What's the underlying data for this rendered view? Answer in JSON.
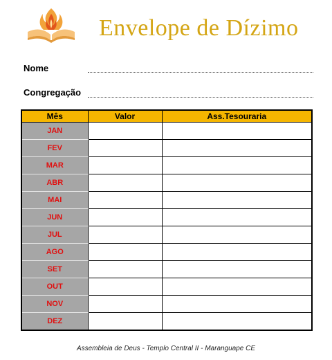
{
  "header": {
    "logo_icon": "bible-flame-logo",
    "title": "Envelope de Dízimo",
    "title_color": "#d4a514"
  },
  "form": {
    "name_label": "Nome",
    "congregation_label": "Congregação"
  },
  "table": {
    "columns": [
      "Mês",
      "Valor",
      "Ass.Tesouraria"
    ],
    "header_color": "#f6b600",
    "month_color": "#e01010",
    "months": [
      "JAN",
      "FEV",
      "MAR",
      "ABR",
      "MAI",
      "JUN",
      "JUL",
      "AGO",
      "SET",
      "OUT",
      "NOV",
      "DEZ"
    ]
  },
  "footer": {
    "text": "Assembleia de Deus  - Templo Central II - Maranguape CE"
  }
}
